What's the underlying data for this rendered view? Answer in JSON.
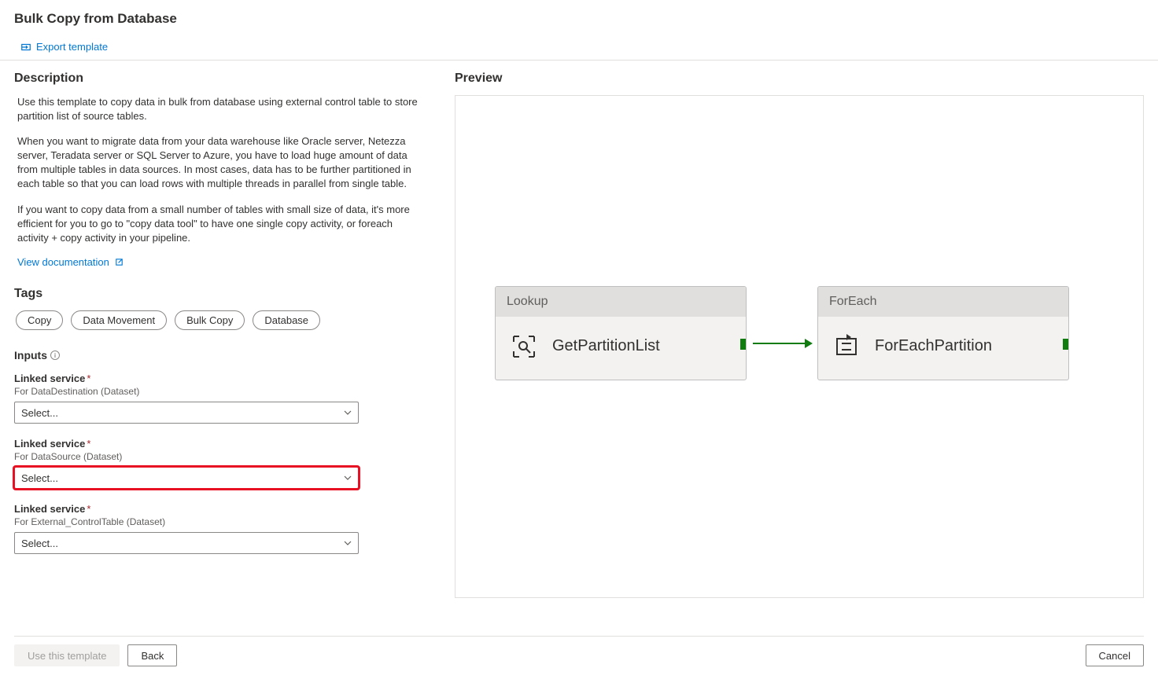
{
  "header": {
    "title": "Bulk Copy from Database"
  },
  "toolbar": {
    "export_label": "Export template"
  },
  "description": {
    "heading": "Description",
    "p1": "Use this template to copy data in bulk from database using external control table to store partition list of source tables.",
    "p2": "When you want to migrate data from your data warehouse like Oracle server, Netezza server, Teradata server or SQL Server to Azure, you have to load huge amount of data from multiple tables in data sources. In most cases, data has to be further partitioned in each table so that you can load rows with multiple threads in parallel from single table.",
    "p3": "If you want to copy data from a small number of tables with small size of data, it's more efficient for you to go to \"copy data tool\" to have one single copy activity, or foreach activity + copy activity in your pipeline.",
    "doc_link": "View documentation"
  },
  "tags": {
    "heading": "Tags",
    "items": [
      "Copy",
      "Data Movement",
      "Bulk Copy",
      "Database"
    ]
  },
  "inputs": {
    "heading": "Inputs",
    "groups": [
      {
        "label": "Linked service",
        "sub": "For DataDestination (Dataset)",
        "value": "Select...",
        "highlight": false
      },
      {
        "label": "Linked service",
        "sub": "For DataSource (Dataset)",
        "value": "Select...",
        "highlight": true
      },
      {
        "label": "Linked service",
        "sub": "For External_ControlTable (Dataset)",
        "value": "Select...",
        "highlight": false
      }
    ]
  },
  "preview": {
    "heading": "Preview",
    "nodes": [
      {
        "type": "Lookup",
        "name": "GetPartitionList"
      },
      {
        "type": "ForEach",
        "name": "ForEachPartition"
      }
    ]
  },
  "footer": {
    "use_template": "Use this template",
    "back": "Back",
    "cancel": "Cancel"
  }
}
